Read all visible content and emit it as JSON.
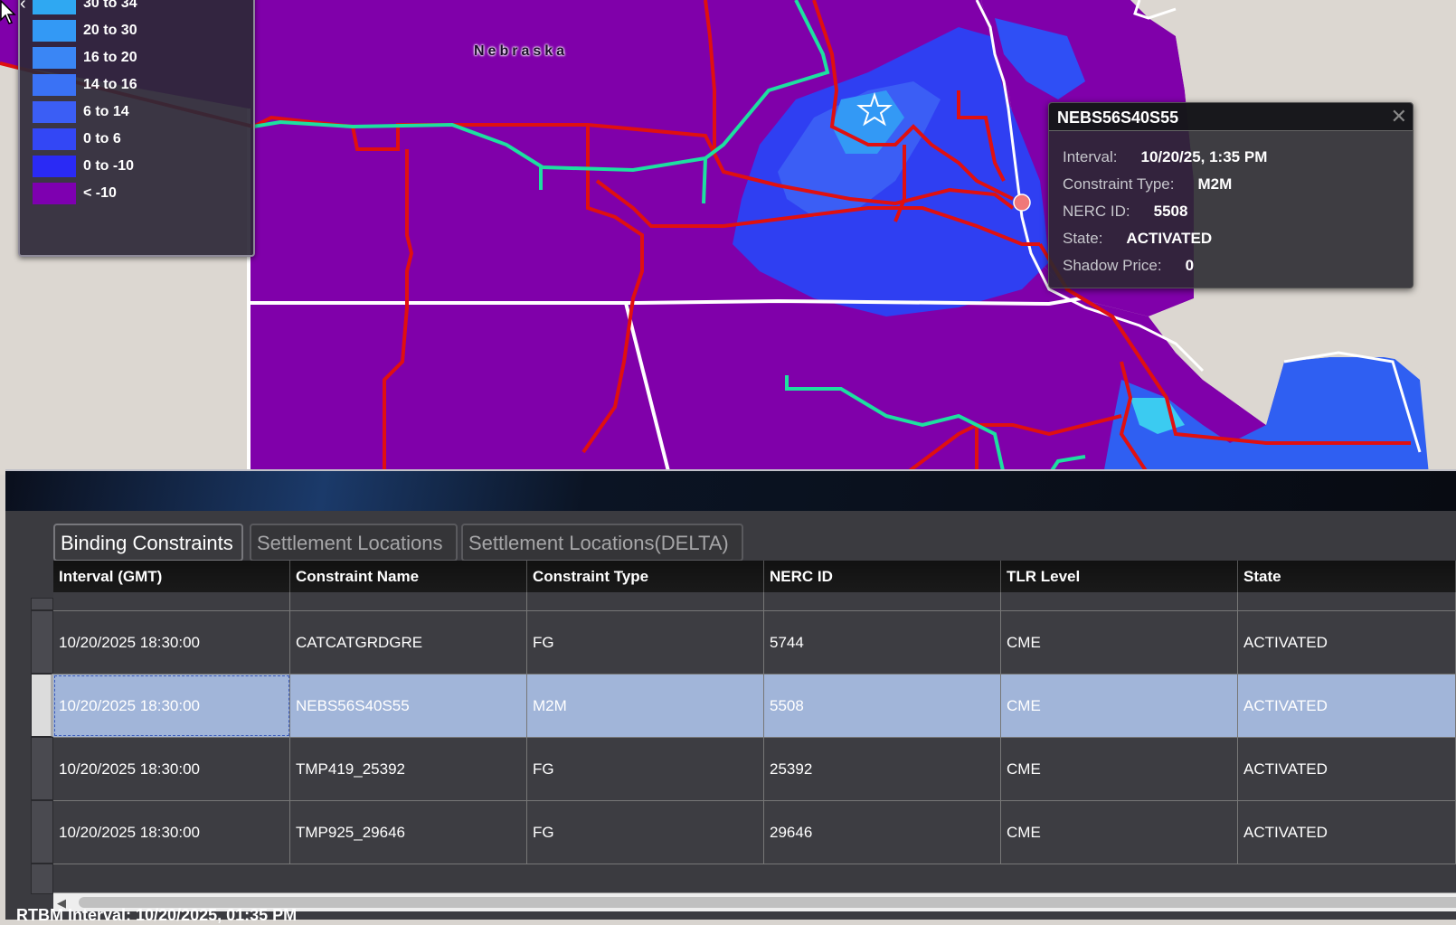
{
  "map": {
    "state_label": "Nebraska"
  },
  "legend": {
    "items": [
      {
        "label": "30 to 34",
        "color": "#2fa8f2"
      },
      {
        "label": "20 to 30",
        "color": "#3399f5"
      },
      {
        "label": "16 to 20",
        "color": "#3a86f5"
      },
      {
        "label": "14 to 16",
        "color": "#3a72f5"
      },
      {
        "label": "6 to 14",
        "color": "#3b5ef5"
      },
      {
        "label": "0 to 6",
        "color": "#3347f5"
      },
      {
        "label": "0 to -10",
        "color": "#2a2af5"
      },
      {
        "label": "< -10",
        "color": "#7e00b0"
      }
    ]
  },
  "popup": {
    "title": "NEBS56S40S55",
    "rows": [
      {
        "key": "Interval:",
        "value": "10/20/25, 1:35 PM"
      },
      {
        "key": "Constraint Type:",
        "value": "M2M"
      },
      {
        "key": "NERC ID:",
        "value": "5508"
      },
      {
        "key": "State:",
        "value": "ACTIVATED"
      },
      {
        "key": "Shadow Price:",
        "value": "0"
      }
    ]
  },
  "tabs": [
    {
      "label": "Binding Constraints",
      "active": true
    },
    {
      "label": "Settlement Locations",
      "active": false
    },
    {
      "label": "Settlement Locations(DELTA)",
      "active": false
    }
  ],
  "grid": {
    "columns": [
      "Interval (GMT)",
      "Constraint Name",
      "Constraint Type",
      "NERC ID",
      "TLR Level",
      "State"
    ],
    "rows": [
      [
        "10/20/2025 18:30:00",
        "CATCATGRDGRE",
        "FG",
        "5744",
        "CME",
        "ACTIVATED"
      ],
      [
        "10/20/2025 18:30:00",
        "NEBS56S40S55",
        "M2M",
        "5508",
        "CME",
        "ACTIVATED"
      ],
      [
        "10/20/2025 18:30:00",
        "TMP419_25392",
        "FG",
        "25392",
        "CME",
        "ACTIVATED"
      ],
      [
        "10/20/2025 18:30:00",
        "TMP925_29646",
        "FG",
        "29646",
        "CME",
        "ACTIVATED"
      ]
    ],
    "selected_row": 1
  },
  "status": {
    "text": "RTBM Interval: 10/20/2025, 01:35 PM"
  }
}
